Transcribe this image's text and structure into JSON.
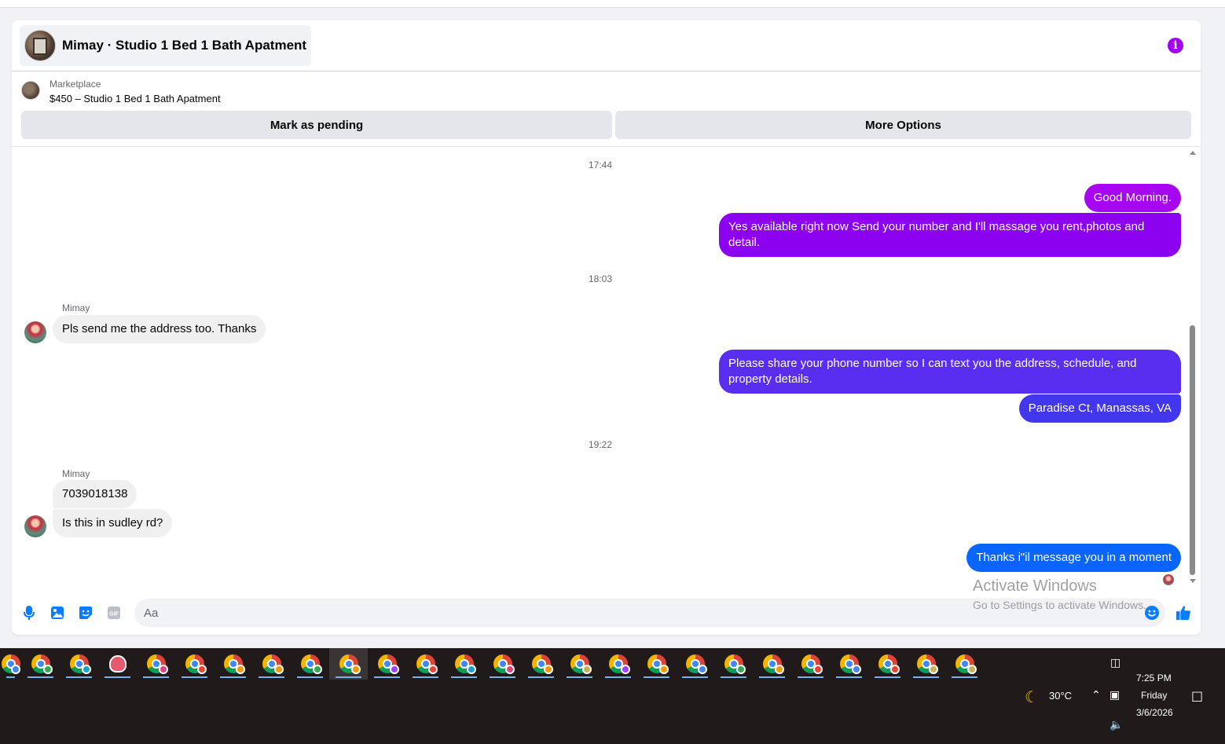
{
  "conversation": {
    "title": "Mimay · Studio 1 Bed 1 Bath Apatment",
    "info_icon": "info-icon"
  },
  "listing": {
    "category": "Marketplace",
    "title": "$450 – Studio 1 Bed 1 Bath Apatment",
    "mark_pending_label": "Mark as pending",
    "more_options_label": "More Options"
  },
  "messages": {
    "ts1": "17:44",
    "m1": "Good Morning.",
    "m2": "Yes available right now Send your number and I'll massage you rent,photos and detail.",
    "ts2": "18:03",
    "sender1": "Mimay",
    "m3": "Pls send me the address too. Thanks",
    "m4": "Please share your phone number so I can text you the address, schedule, and property details.",
    "m5": "Paradise Ct, Manassas, VA",
    "ts3": "19:22",
    "sender2": "Mimay",
    "m6": "7039018138",
    "m7": "Is this in sudley rd?",
    "m8": "Thanks i\"il message you in a moment"
  },
  "composer": {
    "placeholder": "Aa",
    "icons": [
      "microphone-icon",
      "image-icon",
      "sticker-icon",
      "gif-icon",
      "emoji-icon",
      "like-icon"
    ]
  },
  "watermark": {
    "line1": "Activate Windows",
    "line2": "Go to Settings to activate Windows."
  },
  "taskbar": {
    "weather": "30°C",
    "time": "7:25 PM",
    "day": "Friday",
    "date": "3/6/2026"
  },
  "colors": {
    "accent_purple": "#a100f2",
    "bubble_magenta": "#a707f0",
    "bubble_violet": "#8d01f1",
    "bubble_indigo": "#5a2ef0",
    "bubble_royal": "#4337ee",
    "bubble_blue": "#0866ff",
    "composer_blue": "#0a7cff"
  }
}
